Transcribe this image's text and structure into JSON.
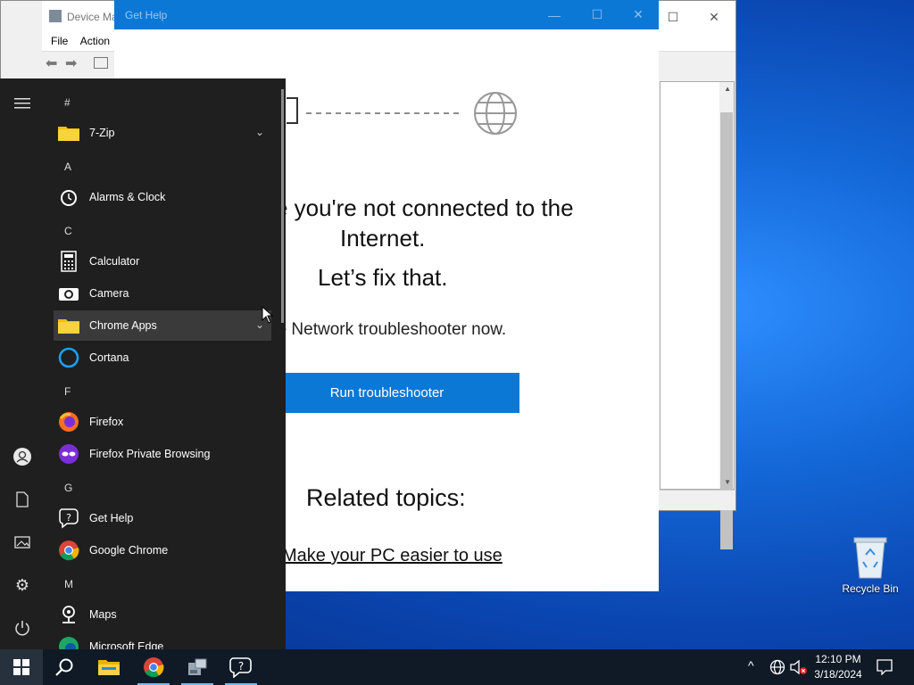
{
  "device_manager": {
    "title": "Device Ma",
    "menu": [
      "File",
      "Action"
    ],
    "minimize": "—",
    "maximize": "☐",
    "close": "✕"
  },
  "get_help": {
    "title": "Get Help",
    "minimize": "—",
    "maximize": "☐",
    "close": "✕",
    "headline_1": "e you're not connected to the",
    "headline_2": "Internet.",
    "headline_3": "Let’s fix that.",
    "instruction": "he Network troubleshooter now.",
    "run_button": "Run troubleshooter",
    "related_heading": "Related topics:",
    "related_link": "Make your PC easier to use"
  },
  "start_menu": {
    "sections": [
      {
        "letter": "#",
        "apps": [
          {
            "label": "7-Zip",
            "icon": "folder-icon",
            "expandable": true
          }
        ]
      },
      {
        "letter": "A",
        "apps": [
          {
            "label": "Alarms & Clock",
            "icon": "alarm-clock-icon"
          }
        ]
      },
      {
        "letter": "C",
        "apps": [
          {
            "label": "Calculator",
            "icon": "calculator-icon"
          },
          {
            "label": "Camera",
            "icon": "camera-icon"
          },
          {
            "label": "Chrome Apps",
            "icon": "folder-icon",
            "expandable": true,
            "highlighted": true
          },
          {
            "label": "Cortana",
            "icon": "cortana-icon"
          }
        ]
      },
      {
        "letter": "F",
        "apps": [
          {
            "label": "Firefox",
            "icon": "firefox-icon"
          },
          {
            "label": "Firefox Private Browsing",
            "icon": "firefox-private-icon"
          }
        ]
      },
      {
        "letter": "G",
        "apps": [
          {
            "label": "Get Help",
            "icon": "get-help-icon"
          },
          {
            "label": "Google Chrome",
            "icon": "chrome-icon"
          }
        ]
      },
      {
        "letter": "M",
        "apps": [
          {
            "label": "Maps",
            "icon": "maps-icon"
          },
          {
            "label": "Microsoft Edge",
            "icon": "edge-icon"
          }
        ]
      }
    ],
    "rail": [
      "hamburger-icon",
      "user-icon",
      "documents-icon",
      "pictures-icon",
      "settings-icon",
      "power-icon"
    ]
  },
  "taskbar": {
    "items": [
      "windows-start-icon",
      "search-icon",
      "file-explorer-icon",
      "chrome-icon",
      "device-manager-icon",
      "get-help-icon"
    ],
    "tray": [
      "chevron-up-icon",
      "network-icon",
      "volume-muted-icon",
      "notification-icon"
    ],
    "time": "12:10 PM",
    "date": "3/18/2024"
  },
  "desktop": {
    "recycle_bin_label": "Recycle Bin"
  },
  "colors": {
    "accent": "#0b78d6",
    "start_bg": "#1f1f1f",
    "taskbar_bg": "#101a26"
  }
}
